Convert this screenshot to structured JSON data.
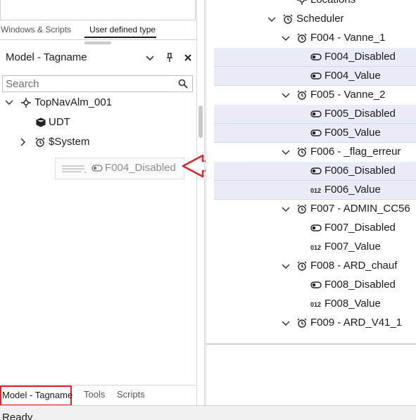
{
  "top_panel": {
    "tabs": [
      "Windows & Scripts",
      "User defined type"
    ]
  },
  "model_panel": {
    "title": "Model - Tagname",
    "search_placeholder": "Search",
    "tree": [
      {
        "label": "TopNavAlm_001",
        "icon": "network-icon",
        "expanded": true
      },
      {
        "label": "UDT",
        "icon": "cube-icon"
      },
      {
        "label": "$System",
        "icon": "alarm-clock-icon",
        "expanded": false
      }
    ],
    "drag_item": {
      "label": "F004_Disabled",
      "icon": "toggle-icon"
    }
  },
  "bottom_tabs": [
    "Model - Tagname",
    "Tools",
    "Scripts"
  ],
  "right_tree": [
    {
      "label": "Locations",
      "icon": "gear-icon",
      "level": 3,
      "chevron": false,
      "highlight": false
    },
    {
      "label": "Scheduler",
      "icon": "alarm-clock-icon",
      "level": 2,
      "chevron": true,
      "highlight": false
    },
    {
      "label": "F004 - Vanne_1",
      "icon": "alarm-clock-icon",
      "level": 3,
      "chevron": true,
      "highlight": false
    },
    {
      "label": "F004_Disabled",
      "icon": "toggle-icon",
      "level": 4,
      "chevron": false,
      "highlight": true
    },
    {
      "label": "F004_Value",
      "icon": "toggle-icon",
      "level": 4,
      "chevron": false,
      "highlight": true
    },
    {
      "label": "F005 - Vanne_2",
      "icon": "alarm-clock-icon",
      "level": 3,
      "chevron": true,
      "highlight": false
    },
    {
      "label": "F005_Disabled",
      "icon": "toggle-icon",
      "level": 4,
      "chevron": false,
      "highlight": true
    },
    {
      "label": "F005_Value",
      "icon": "toggle-icon",
      "level": 4,
      "chevron": false,
      "highlight": true
    },
    {
      "label": "F006 - _flag_erreur",
      "icon": "alarm-clock-icon",
      "level": 3,
      "chevron": true,
      "highlight": false
    },
    {
      "label": "F006_Disabled",
      "icon": "toggle-icon",
      "level": 4,
      "chevron": false,
      "highlight": true
    },
    {
      "label": "F006_Value",
      "icon": "numeric-icon",
      "level": 4,
      "chevron": false,
      "highlight": true
    },
    {
      "label": "F007 - ADMIN_CC56",
      "icon": "alarm-clock-icon",
      "level": 3,
      "chevron": true,
      "highlight": false
    },
    {
      "label": "F007_Disabled",
      "icon": "toggle-icon",
      "level": 4,
      "chevron": false,
      "highlight": false
    },
    {
      "label": "F007_Value",
      "icon": "numeric-icon",
      "level": 4,
      "chevron": false,
      "highlight": false
    },
    {
      "label": "F008 - ARD_chauf",
      "icon": "alarm-clock-icon",
      "level": 3,
      "chevron": true,
      "highlight": false
    },
    {
      "label": "F008_Disabled",
      "icon": "toggle-icon",
      "level": 4,
      "chevron": false,
      "highlight": false
    },
    {
      "label": "F008_Value",
      "icon": "numeric-icon",
      "level": 4,
      "chevron": false,
      "highlight": false
    },
    {
      "label": "F009 - ARD_V41_1",
      "icon": "alarm-clock-icon",
      "level": 3,
      "chevron": true,
      "highlight": false
    }
  ],
  "status_bar": {
    "text": "Ready"
  },
  "colors": {
    "highlight_row": "#e9ebf7",
    "annotation_red": "#e0242c"
  }
}
